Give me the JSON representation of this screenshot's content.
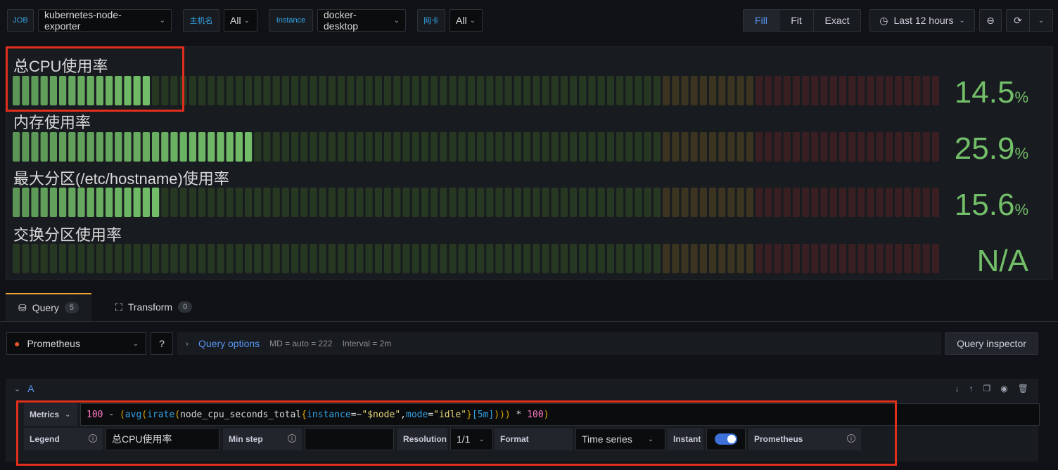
{
  "toolbar": {
    "job_label": "JOB",
    "job_value": "kubernetes-node-exporter",
    "host_label": "主机名",
    "host_value": "All",
    "instance_label": "Instance",
    "instance_value": "docker-desktop",
    "nic_label": "网卡",
    "nic_value": "All",
    "fill_label": "Fill",
    "fit_label": "Fit",
    "exact_label": "Exact",
    "time_range": "Last 12 hours",
    "clock_icon": "clock-icon",
    "zoom_icon": "zoom-out-icon",
    "refresh_icon": "refresh-icon"
  },
  "gauges": [
    {
      "title": "总CPU使用率",
      "value": "14.5",
      "unit": "%",
      "fraction": 0.145
    },
    {
      "title": "内存使用率",
      "value": "25.9",
      "unit": "%",
      "fraction": 0.259
    },
    {
      "title": "最大分区(/etc/hostname)使用率",
      "value": "15.6",
      "unit": "%",
      "fraction": 0.156
    },
    {
      "title": "交换分区使用率",
      "value": "N/A",
      "unit": "",
      "fraction": 0
    }
  ],
  "colors": {
    "green_on": "#73bf69",
    "green_off": "#263722",
    "yellow_off": "#3a3420",
    "red_off": "#3a1f22",
    "threshold_yellow": 0.7,
    "threshold_red": 0.8,
    "highlight": "#e02f1c"
  },
  "tabs": {
    "query_label": "Query",
    "query_count": "5",
    "transform_label": "Transform",
    "transform_count": "0"
  },
  "datasource": {
    "name": "Prometheus",
    "query_options_label": "Query options",
    "md": "MD = auto = 222",
    "interval": "Interval = 2m",
    "inspector_label": "Query inspector"
  },
  "query": {
    "ref": "A",
    "metrics_label": "Metrics",
    "expr_parts": [
      [
        "c-num",
        "100"
      ],
      [
        "c-txt",
        " - "
      ],
      [
        "c-brk",
        "("
      ],
      [
        "c-fn",
        "avg"
      ],
      [
        "c-brk",
        "("
      ],
      [
        "c-fn",
        "irate"
      ],
      [
        "c-brk",
        "("
      ],
      [
        "c-txt",
        "node_cpu_seconds_total"
      ],
      [
        "c-brk",
        "{"
      ],
      [
        "c-fn",
        "instance"
      ],
      [
        "c-txt",
        "=~"
      ],
      [
        "c-str",
        "\"$node\""
      ],
      [
        "c-txt",
        ","
      ],
      [
        "c-fn",
        "mode"
      ],
      [
        "c-txt",
        "="
      ],
      [
        "c-str",
        "\"idle\""
      ],
      [
        "c-brk",
        "}"
      ],
      [
        "c-fn",
        "[5m]"
      ],
      [
        "c-brk",
        ")))"
      ],
      [
        "c-txt",
        " * "
      ],
      [
        "c-num",
        "100"
      ],
      [
        "c-brk",
        ")"
      ]
    ],
    "legend_label": "Legend",
    "legend_value": "总CPU使用率",
    "minstep_label": "Min step",
    "minstep_value": "",
    "resolution_label": "Resolution",
    "resolution_value": "1/1",
    "format_label": "Format",
    "format_value": "Time series",
    "instant_label": "Instant",
    "instant_on": true,
    "prom_label": "Prometheus"
  }
}
